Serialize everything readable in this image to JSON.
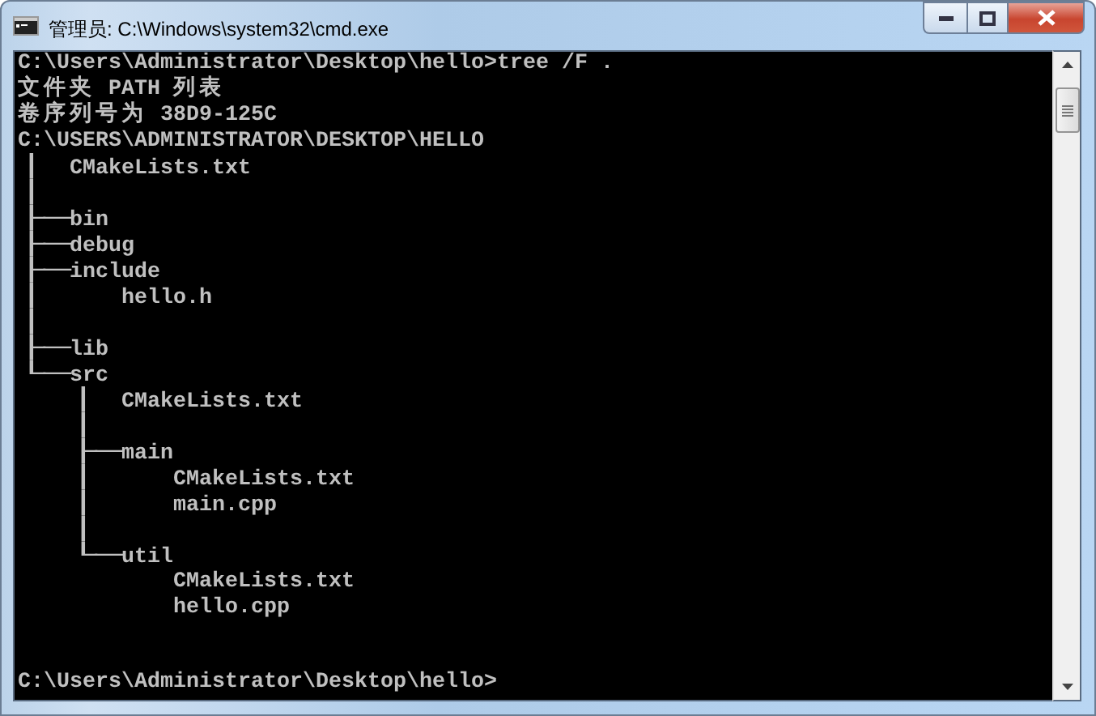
{
  "window": {
    "title": "管理员: C:\\Windows\\system32\\cmd.exe"
  },
  "console": {
    "lines": [
      "C:\\Users\\Administrator\\Desktop\\hello>tree /F .",
      "文件夹 PATH 列表",
      "卷序列号为 38D9-125C",
      "C:\\USERS\\ADMINISTRATOR\\DESKTOP\\HELLO",
      "│  CMakeLists.txt",
      "│",
      "├─bin",
      "├─debug",
      "├─include",
      "│      hello.h",
      "│",
      "├─lib",
      "└─src",
      "    │  CMakeLists.txt",
      "    │",
      "    ├─main",
      "    │      CMakeLists.txt",
      "    │      main.cpp",
      "    │",
      "    └─util",
      "            CMakeLists.txt",
      "            hello.cpp"
    ],
    "prompt": "C:\\Users\\Administrator\\Desktop\\hello>"
  }
}
